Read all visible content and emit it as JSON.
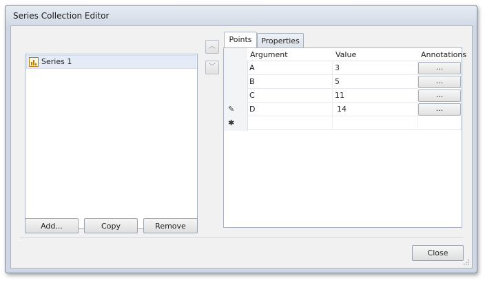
{
  "window": {
    "title": "Series Collection Editor"
  },
  "series_list": {
    "items": [
      {
        "label": "Series 1",
        "selected": true
      }
    ]
  },
  "list_buttons": {
    "add": "Add...",
    "copy": "Copy",
    "remove": "Remove"
  },
  "move": {
    "up_icon": "chevron-up-icon",
    "down_icon": "chevron-down-icon"
  },
  "tabs": [
    {
      "label": "Points",
      "active": true
    },
    {
      "label": "Properties",
      "active": false
    }
  ],
  "grid": {
    "columns": [
      "Argument",
      "Value",
      "Annotations"
    ],
    "rows": [
      {
        "argument": "A",
        "value": "3",
        "annotations": "..."
      },
      {
        "argument": "B",
        "value": "5",
        "annotations": "..."
      },
      {
        "argument": "C",
        "value": "11",
        "annotations": "..."
      },
      {
        "argument": "D",
        "value": "14",
        "annotations": "...",
        "indicator": "✎"
      }
    ],
    "new_row_indicator": "✱"
  },
  "footer": {
    "close": "Close"
  }
}
